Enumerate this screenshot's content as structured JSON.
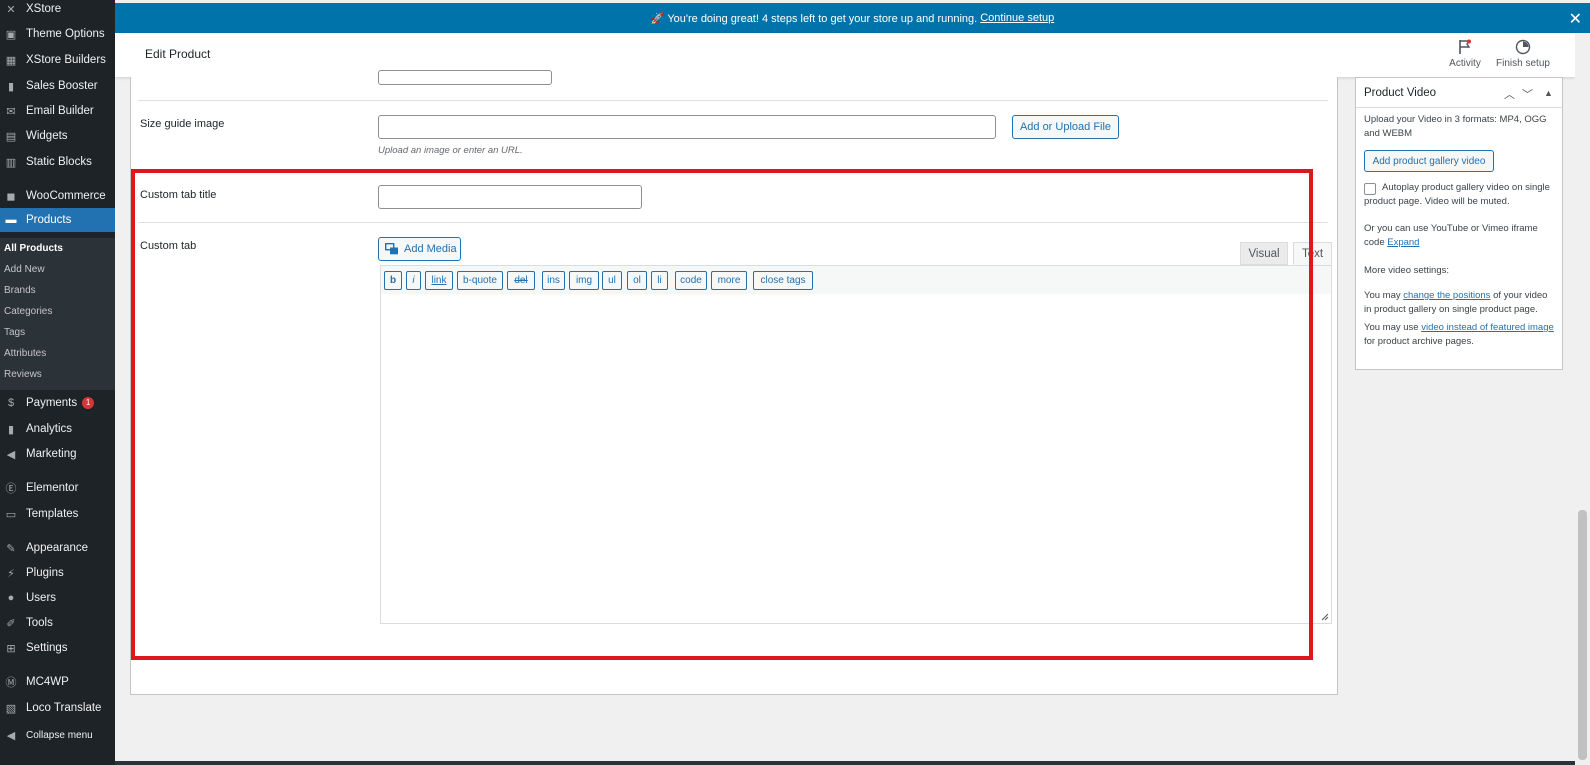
{
  "sidebar": {
    "items": [
      {
        "label": "XStore",
        "icon": "xstore-icon",
        "glyph": "✕"
      },
      {
        "label": "Theme Options",
        "icon": "theme-options-icon",
        "glyph": "▣"
      },
      {
        "label": "XStore Builders",
        "icon": "builders-icon",
        "glyph": "▦"
      },
      {
        "label": "Sales Booster",
        "icon": "sales-booster-icon",
        "glyph": "▮"
      },
      {
        "label": "Email Builder",
        "icon": "email-icon",
        "glyph": "✉"
      },
      {
        "label": "Widgets",
        "icon": "widgets-icon",
        "glyph": "▤"
      },
      {
        "label": "Static Blocks",
        "icon": "static-blocks-icon",
        "glyph": "▥"
      },
      {
        "label": "WooCommerce",
        "icon": "woocommerce-icon",
        "glyph": "◼"
      },
      {
        "label": "Products",
        "icon": "products-icon",
        "glyph": "▬"
      },
      {
        "label": "Payments",
        "icon": "payments-icon",
        "glyph": "$",
        "badge": "1"
      },
      {
        "label": "Analytics",
        "icon": "analytics-icon",
        "glyph": "▮"
      },
      {
        "label": "Marketing",
        "icon": "marketing-icon",
        "glyph": "◀"
      },
      {
        "label": "Elementor",
        "icon": "elementor-icon",
        "glyph": "Ⓔ"
      },
      {
        "label": "Templates",
        "icon": "templates-icon",
        "glyph": "▭"
      },
      {
        "label": "Appearance",
        "icon": "appearance-icon",
        "glyph": "✎"
      },
      {
        "label": "Plugins",
        "icon": "plugins-icon",
        "glyph": "⚡"
      },
      {
        "label": "Users",
        "icon": "users-icon",
        "glyph": "●"
      },
      {
        "label": "Tools",
        "icon": "tools-icon",
        "glyph": "✐"
      },
      {
        "label": "Settings",
        "icon": "settings-icon",
        "glyph": "⊞"
      },
      {
        "label": "MC4WP",
        "icon": "mc4wp-icon",
        "glyph": "Ⓜ"
      },
      {
        "label": "Loco Translate",
        "icon": "loco-icon",
        "glyph": "▧"
      },
      {
        "label": "Collapse menu",
        "icon": "collapse-icon",
        "glyph": "◀"
      }
    ],
    "submenu": [
      "All Products",
      "Add New",
      "Brands",
      "Categories",
      "Tags",
      "Attributes",
      "Reviews"
    ]
  },
  "notice": {
    "text": "🚀 You're doing great! 4 steps left to get your store up and running.",
    "link": "Continue setup"
  },
  "topbar": {
    "title": "Edit Product",
    "activity": "Activity",
    "finish_setup": "Finish setup"
  },
  "form": {
    "size_guide_label": "Size guide image",
    "upload_button": "Add or Upload File",
    "upload_hint": "Upload an image or enter an URL.",
    "custom_tab_title_label": "Custom tab title",
    "custom_tab_label": "Custom tab",
    "add_media": "Add Media",
    "tab_visual": "Visual",
    "tab_text": "Text",
    "quicktags": [
      "b",
      "i",
      "link",
      "b-quote",
      "del",
      "ins",
      "img",
      "ul",
      "ol",
      "li",
      "code",
      "more",
      "close tags"
    ]
  },
  "video_box": {
    "title": "Product Video",
    "intro": "Upload your Video in 3 formats: MP4, OGG and WEBM",
    "add_button": "Add product gallery video",
    "autoplay_label": "Autoplay product gallery video on single product page. Video will be muted.",
    "iframe_text": "Or you can use YouTube or Vimeo iframe code",
    "expand_link": "Expand",
    "more_settings": "More video settings:",
    "positions_pre": "You may",
    "positions_link": "change the positions",
    "positions_post": "of your video in product gallery on single product page.",
    "featured_pre": "You may use",
    "featured_link": "video instead of featured image",
    "featured_post": "for product archive pages."
  },
  "colors": {
    "admin_sidebar": "#1d2327",
    "accent": "#2271b1",
    "notice_bar": "#0073aa",
    "highlight": "#e0161f"
  }
}
